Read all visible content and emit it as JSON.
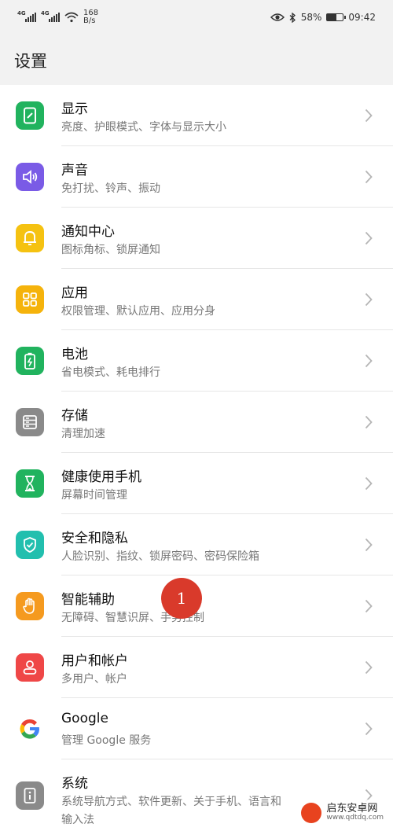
{
  "status": {
    "sim1": "4G",
    "sim2": "4G",
    "speed_value": "168",
    "speed_unit": "B/s",
    "battery_percent": "58%",
    "battery_level": 0.58,
    "time": "09:42"
  },
  "page_title": "设置",
  "items": [
    {
      "title": "显示",
      "sub": "亮度、护眼模式、字体与显示大小",
      "icon": "display-icon",
      "color": "#21b35e"
    },
    {
      "title": "声音",
      "sub": "免打扰、铃声、振动",
      "icon": "sound-icon",
      "color": "#7a5be6"
    },
    {
      "title": "通知中心",
      "sub": "图标角标、锁屏通知",
      "icon": "bell-icon",
      "color": "#f5c211"
    },
    {
      "title": "应用",
      "sub": "权限管理、默认应用、应用分身",
      "icon": "apps-icon",
      "color": "#f5b30c"
    },
    {
      "title": "电池",
      "sub": "省电模式、耗电排行",
      "icon": "battery-icon",
      "color": "#21b35e"
    },
    {
      "title": "存储",
      "sub": "清理加速",
      "icon": "storage-icon",
      "color": "#8a8a8a"
    },
    {
      "title": "健康使用手机",
      "sub": "屏幕时间管理",
      "icon": "hourglass-icon",
      "color": "#21b35e"
    },
    {
      "title": "安全和隐私",
      "sub": "人脸识别、指纹、锁屏密码、密码保险箱",
      "icon": "shield-icon",
      "color": "#22bfae"
    },
    {
      "title": "智能辅助",
      "sub": "无障碍、智慧识屏、手势控制",
      "icon": "hand-icon",
      "color": "#f59a1f"
    },
    {
      "title": "用户和帐户",
      "sub": "多用户、帐户",
      "icon": "user-icon",
      "color": "#ef4747"
    },
    {
      "title": "Google",
      "sub": "管理 Google 服务",
      "icon": "google-icon",
      "color": "#ffffff"
    },
    {
      "title": "系统",
      "sub": "系统导航方式、软件更新、关于手机、语言和",
      "sub2": "输入法",
      "icon": "system-icon",
      "color": "#8a8a8a"
    }
  ],
  "annotation_badge": "1",
  "watermark": {
    "name": "启东安卓网",
    "url": "www.qdtdq.com"
  }
}
